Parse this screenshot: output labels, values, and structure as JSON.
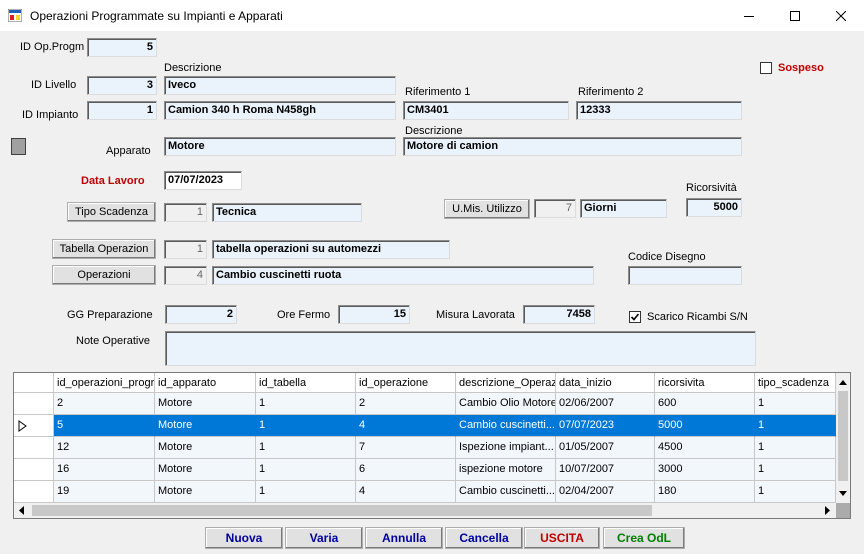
{
  "window": {
    "title": "Operazioni Programmate su Impianti e Apparati"
  },
  "labels": {
    "id_op_progm": "ID Op.Progm",
    "id_livello": "ID Livello",
    "id_impianto": "ID Impianto",
    "descrizione1": "Descrizione",
    "descrizione2": "Descrizione",
    "riferimento1": "Riferimento 1",
    "riferimento2": "Riferimento 2",
    "apparato": "Apparato",
    "data_lavoro": "Data Lavoro",
    "ricorsivita": "Ricorsività",
    "codice_disegno": "Codice Disegno",
    "gg_preparazione": "GG Preparazione",
    "ore_fermo": "Ore Fermo",
    "misura_lavorata": "Misura Lavorata",
    "note_operative": "Note Operative",
    "sospeso": "Sospeso",
    "scarico_ricambi": "Scarico Ricambi S/N"
  },
  "fields": {
    "id_op_progm": "5",
    "id_livello": "3",
    "livello_desc": "Iveco",
    "id_impianto": "1",
    "impianto_desc": "Camion 340 h Roma N458gh",
    "riferimento1": "CM3401",
    "riferimento2": "12333",
    "apparato": "Motore",
    "apparato_desc": "Motore di camion",
    "data_lavoro": "07/07/2023",
    "tipo_scadenza_id": "1",
    "tipo_scadenza_desc": "Tecnica",
    "umis_id": "7",
    "umis_desc": "Giorni",
    "ricorsivita": "5000",
    "tabella_id": "1",
    "tabella_desc": "tabella operazioni su automezzi",
    "operazione_id": "4",
    "operazione_desc": "Cambio cuscinetti ruota",
    "codice_disegno": "",
    "gg_preparazione": "2",
    "ore_fermo": "15",
    "misura_lavorata": "7458",
    "note_operative": ""
  },
  "checks": {
    "sospeso": false,
    "scarico_ricambi": true
  },
  "buttons": {
    "tipo_scadenza": "Tipo Scadenza",
    "umis_utilizzo": "U.Mis. Utilizzo",
    "tabella_operazion": "Tabella Operazion",
    "operazioni": "Operazioni",
    "nuova": "Nuova",
    "varia": "Varia",
    "annulla": "Annulla",
    "cancella": "Cancella",
    "uscita": "USCITA",
    "crea_odl": "Crea OdL"
  },
  "colors": {
    "btn_blue": "#0000a0",
    "btn_red": "#c00000",
    "btn_green": "#008000",
    "selection": "#0078d7",
    "field_bg": "#eaf2fb"
  },
  "grid": {
    "columns": [
      "id_operazioni_progr",
      "id_apparato",
      "id_tabella",
      "id_operazione",
      "descrizione_Operaz",
      "data_inizio",
      "ricorsivita",
      "tipo_scadenza"
    ],
    "rows": [
      [
        "2",
        "Motore",
        "1",
        "2",
        "Cambio Olio Motore",
        "02/06/2007",
        "600",
        "1"
      ],
      [
        "5",
        "Motore",
        "1",
        "4",
        "Cambio cuscinetti...",
        "07/07/2023",
        "5000",
        "1"
      ],
      [
        "12",
        "Motore",
        "1",
        "7",
        "Ispezione impiant...",
        "01/05/2007",
        "4500",
        "1"
      ],
      [
        "16",
        "Motore",
        "1",
        "6",
        "ispezione motore",
        "10/07/2007",
        "3000",
        "1"
      ],
      [
        "19",
        "Motore",
        "1",
        "4",
        "Cambio cuscinetti...",
        "02/04/2007",
        "180",
        "1"
      ]
    ],
    "selected_row": 1
  }
}
